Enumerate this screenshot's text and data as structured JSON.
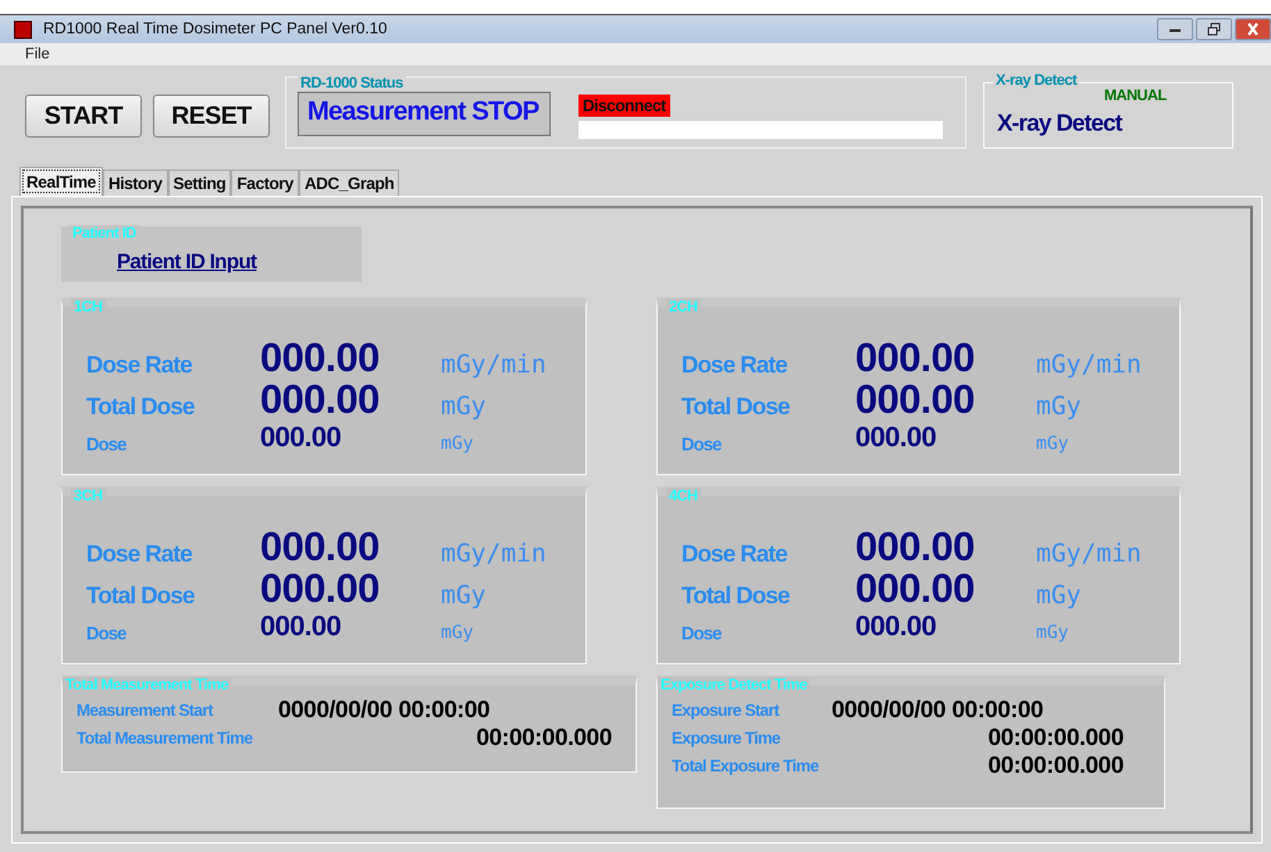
{
  "window": {
    "title": "RD1000 Real Time Dosimeter  PC Panel Ver0.10"
  },
  "menu": [
    "File"
  ],
  "buttons": [
    "START",
    "RESET"
  ],
  "status": {
    "title": "RD-1000 Status",
    "value": "Measurement STOP"
  },
  "connection": {
    "label": "Disconnect"
  },
  "xray": {
    "title": "X-ray Detect",
    "mode": "MANUAL",
    "value": "X-ray Detect"
  },
  "tabs": [
    {
      "label": "RealTime",
      "selected": true
    },
    {
      "label": "History",
      "selected": false
    },
    {
      "label": "Setting",
      "selected": false
    },
    {
      "label": "Factory",
      "selected": false
    },
    {
      "label": "ADC_Graph",
      "selected": false
    }
  ],
  "patient": {
    "title": "Patient ID",
    "link": "Patient ID Input"
  },
  "channels": [
    {
      "name": "1CH",
      "rows": [
        {
          "kind": "large",
          "label": "Dose Rate",
          "value": "000.00",
          "unit": "mGy/min"
        },
        {
          "kind": "large",
          "label": "Total Dose",
          "value": "000.00",
          "unit": "mGy"
        },
        {
          "kind": "small",
          "label": "Dose",
          "value": "000.00",
          "unit": "mGy"
        }
      ]
    },
    {
      "name": "2CH",
      "rows": [
        {
          "kind": "large",
          "label": "Dose Rate",
          "value": "000.00",
          "unit": "mGy/min"
        },
        {
          "kind": "large",
          "label": "Total Dose",
          "value": "000.00",
          "unit": "mGy"
        },
        {
          "kind": "small",
          "label": "Dose",
          "value": "000.00",
          "unit": "mGy"
        }
      ]
    },
    {
      "name": "3CH",
      "rows": [
        {
          "kind": "large",
          "label": "Dose Rate",
          "value": "000.00",
          "unit": "mGy/min"
        },
        {
          "kind": "large",
          "label": "Total Dose",
          "value": "000.00",
          "unit": "mGy"
        },
        {
          "kind": "small",
          "label": "Dose",
          "value": "000.00",
          "unit": "mGy"
        }
      ]
    },
    {
      "name": "4CH",
      "rows": [
        {
          "kind": "large",
          "label": "Dose Rate",
          "value": "000.00",
          "unit": "mGy/min"
        },
        {
          "kind": "large",
          "label": "Total Dose",
          "value": "000.00",
          "unit": "mGy"
        },
        {
          "kind": "small",
          "label": "Dose",
          "value": "000.00",
          "unit": "mGy"
        }
      ]
    }
  ],
  "times": [
    {
      "title": "Total Measurement Time",
      "rows": [
        {
          "kind": "datetime",
          "label": "Measurement Start",
          "value": "0000/00/00 00:00:00"
        },
        {
          "kind": "duration",
          "label": "Total Measurement Time",
          "value": "00:00:00.000"
        }
      ]
    },
    {
      "title": "Exposure Detect Time",
      "rows": [
        {
          "kind": "datetime",
          "label": "Exposure Start",
          "value": "0000/00/00 00:00:00"
        },
        {
          "kind": "duration",
          "label": "Exposure Time",
          "value": "00:00:00.000"
        },
        {
          "kind": "duration",
          "label": "Total Exposure Time",
          "value": "00:00:00.000"
        }
      ]
    }
  ]
}
